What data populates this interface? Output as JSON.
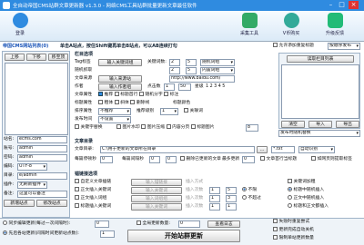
{
  "window": {
    "title": "全自动帝国CMS站群文章更新器 v1.3.0 - 网络CMS工具站群批量更新文章最佳软件"
  },
  "toolbar": {
    "items": [
      {
        "label": "登录",
        "icon": "user-icon",
        "color": "#2f8be0"
      },
      {
        "label": "采集工具",
        "icon": "tools-icon",
        "color": "#3a6"
      },
      {
        "label": "V币购买",
        "icon": "coin-icon",
        "color": "#3a9"
      },
      {
        "label": "升级反馈",
        "icon": "arrow-up-icon",
        "color": "#2b7"
      }
    ]
  },
  "site_panel": {
    "header": "帝国CMS网站列表(0)",
    "hint": "单击A站点，按住Shift键再单击B站点，可以AB连续打勾",
    "tab_buttons": [
      "上移",
      "下移",
      "移至顶"
    ],
    "fields": [
      {
        "label": "站名:",
        "value": "ecms.com"
      },
      {
        "label": "账号:",
        "value": "admin"
      },
      {
        "label": "密码:",
        "value": "admin"
      },
      {
        "label": "编码:",
        "value": "UTF-8"
      },
      {
        "label": "目录:",
        "value": "e/admin"
      },
      {
        "label": "插件:",
        "value": "无刷新插件"
      },
      {
        "label": "备注:",
        "value": "这里可以备注"
      }
    ],
    "buttons": [
      "新增站点",
      "修改站点"
    ],
    "auth_label": "读取"
  },
  "article_section": {
    "title": "栏目选项",
    "tag_label": "Tag标签",
    "tag_btn": "输入关键词组",
    "keyword_label": "关键词数:",
    "keyword_from": "2",
    "keyword_to": "5",
    "keyword_method": "随机词组",
    "fetch_label": "随机抓取",
    "fetch_from": "2",
    "fetch_to": "5",
    "fetch_method": "内置词组",
    "source_label": "文章来源",
    "source_btn": "输入来源站",
    "url_prefix": "http://www.baidu.com/",
    "author_label": "作者",
    "author_btn": "输入作者组",
    "click_label": "点击数",
    "click_from": "1",
    "click_to": "50",
    "star_label": "星级",
    "star_value": "1 2 3 4 5",
    "attr_label": "文章属性",
    "attrs": [
      "推荐",
      "标题首行",
      "随机分字",
      "标注"
    ],
    "title_attr_label": "标题属性",
    "attr2": [
      "粗体",
      "斜体",
      "删除线"
    ],
    "color_label": "标题颜色",
    "sort_label": "排序属性",
    "sort_value": "不推荐",
    "level_label": "推荐级别",
    "level_value": "1",
    "related_label": "关联词",
    "time_label": "发布时间",
    "time_value": "不设置",
    "keyword_replace": "关键字替换",
    "image_options": [
      "图片水印",
      "图片压缩",
      "内容分页",
      "标题图片"
    ],
    "page_len": "8"
  },
  "rightpanel": {
    "check_label": "允许添加重复标题",
    "order_btn": "按顺序发布",
    "header": "读取栏目列表",
    "empty_button": "清空",
    "import_button": "导入",
    "export_button": "导出",
    "list_label": "栏目列表",
    "bottom_check": "发布时随机替换"
  },
  "filter": {
    "label": "选择文章保存目录",
    "chars_label": "字数",
    "chars": "0"
  },
  "content_section": {
    "title": "文章目录",
    "dir_label": "文章目录:",
    "dir_path": "C:\\用于更新的文章所在目录",
    "browse_btn": "...",
    "ext": "*.txt",
    "encoding": "自动识别",
    "publish_label": "每篇停顿秒",
    "publish_value": "0",
    "interval_label": "每篇间隔秒",
    "interval_from": "0",
    "interval_to": "0",
    "delete_after": "删除已更新的文章",
    "max_label": "最多更新",
    "max_value": "0",
    "opt_tail": "文章首行当标题",
    "opt_tail2": "如网页则提取标签"
  },
  "keyword_section": {
    "title": "锚链接选项",
    "rows": [
      {
        "label": "自定义文章插链",
        "btn": "输入锚链接",
        "hint": "插入方式"
      },
      {
        "label": "正文插入关键词",
        "btn": "输入关键词",
        "from": "1",
        "to": "5",
        "hint": "插入次数"
      },
      {
        "label": "正文插入词组",
        "btn": "输入词组组",
        "from": "1",
        "to": "3",
        "hint": "插入次数"
      },
      {
        "label": "标题插入关键词",
        "btn": "输入关键词",
        "from": "1",
        "to": "1",
        "hint": "插入次数"
      }
    ],
    "right_checks": [
      "关键词加粗",
      "标题中随机插入",
      "正文中随机插入",
      "标题和正文都插入"
    ],
    "mode_label": "不限",
    "mode2": "不超过"
  },
  "bottom": {
    "sync_label": "同步编辑更新(每过一次间隔时):",
    "sync_value": "0",
    "task_label": "全局更新数量:",
    "task_value": "0",
    "view_log": "查看日志",
    "radio2": "先后各站更新(间隔时间更新站点数):",
    "radio2_value": "1",
    "start_btn": "开始站群更新",
    "right_checks": [
      "失败时重复尝试",
      "更新完成自动关机",
      "限制单站更新数量"
    ]
  },
  "colors": {
    "title_bar": "#2f8be0",
    "panel": "#eef3f8",
    "accent": "#1a54b8"
  }
}
